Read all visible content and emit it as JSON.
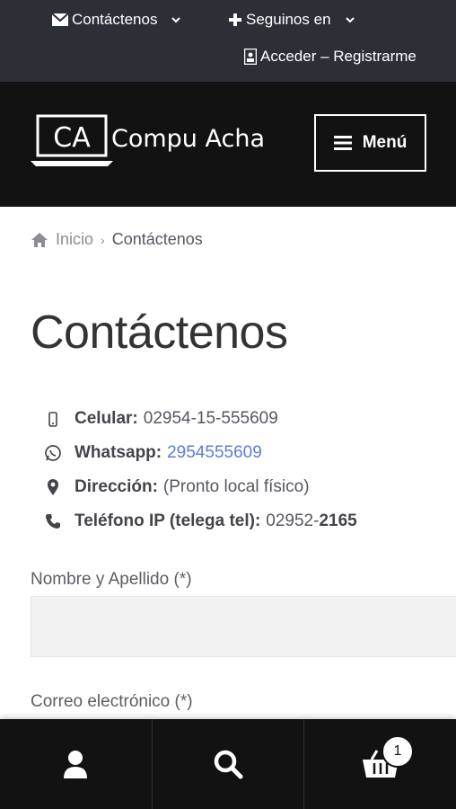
{
  "topbar": {
    "contact_label": "Contáctenos",
    "follow_label": "Seguinos en",
    "login_label": "Acceder – Registrarme"
  },
  "header": {
    "logo_badge": "CA",
    "logo_text": "Compu Acha",
    "menu_label": "Menú"
  },
  "breadcrumb": {
    "home": "Inicio",
    "current": "Contáctenos"
  },
  "page": {
    "title": "Contáctenos"
  },
  "contact_info": [
    {
      "icon": "mobile-icon",
      "label": "Celular:",
      "value": "02954-15-555609"
    },
    {
      "icon": "whatsapp-icon",
      "label": "Whatsapp:",
      "value": "2954555609"
    },
    {
      "icon": "map-pin-icon",
      "label": "Dirección:",
      "value": "(Pronto local físico)"
    },
    {
      "icon": "phone-icon",
      "label": "Teléfono IP (telega tel):",
      "value_prefix": "02952-",
      "value_bold": "2165"
    }
  ],
  "form": {
    "name_label": "Nombre y Apellido (*)",
    "email_label": "Correo electrónico (*)"
  },
  "bottom_bar": {
    "cart_count": "1"
  },
  "colors": {
    "topbar_bg": "#2b3037",
    "header_bg": "#121212",
    "link": "#5b7be0"
  }
}
